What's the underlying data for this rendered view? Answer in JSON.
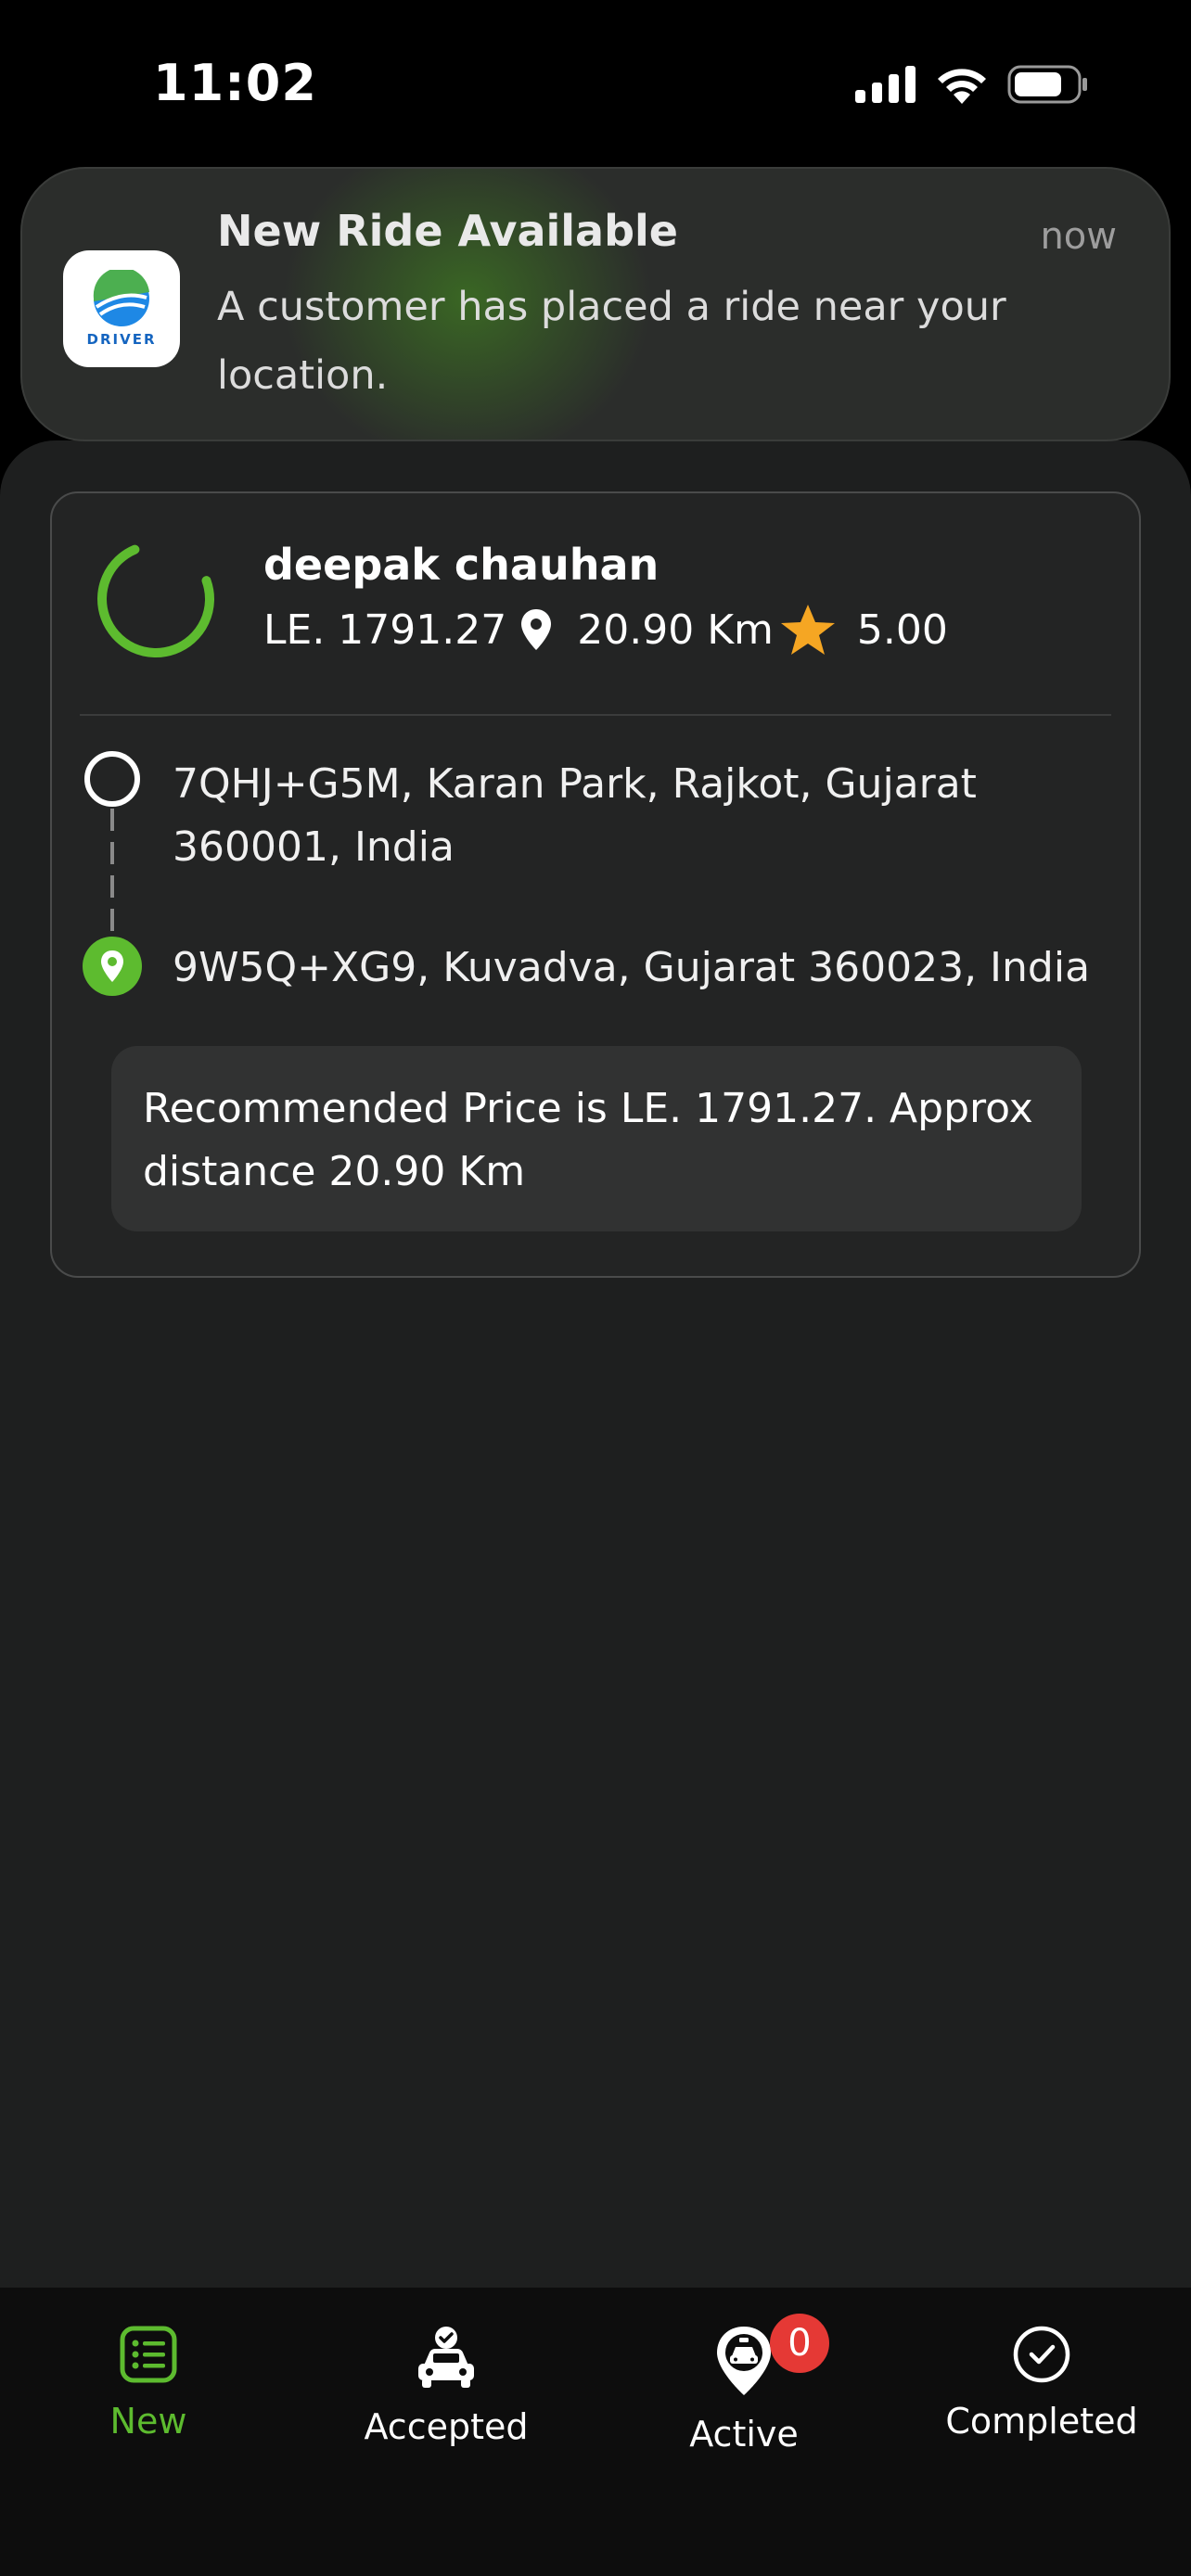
{
  "status_bar": {
    "time": "11:02"
  },
  "notification": {
    "app_brand": "DRIVER",
    "title": "New Ride Available",
    "body": "A customer has placed a ride near your location.",
    "time": "now"
  },
  "ride": {
    "rider_name": "deepak chauhan",
    "price": "LE. 1791.27",
    "distance": "20.90 Km",
    "rating": "5.00",
    "pickup": "7QHJ+G5M, Karan Park, Rajkot, Gujarat 360001, India",
    "dropoff": "9W5Q+XG9, Kuvadva, Gujarat 360023, India",
    "recommendation": "Recommended Price is LE. 1791.27. Approx distance 20.90 Km"
  },
  "nav": {
    "items": [
      {
        "label": "New",
        "icon": "list-icon",
        "active": true
      },
      {
        "label": "Accepted",
        "icon": "car-check-icon",
        "active": false
      },
      {
        "label": "Active",
        "icon": "taxi-pin-icon",
        "active": false,
        "badge": "0"
      },
      {
        "label": "Completed",
        "icon": "check-circle-icon",
        "active": false
      }
    ]
  },
  "colors": {
    "accent": "#5dbb2f",
    "badge": "#e53935",
    "star": "#f5a623"
  }
}
